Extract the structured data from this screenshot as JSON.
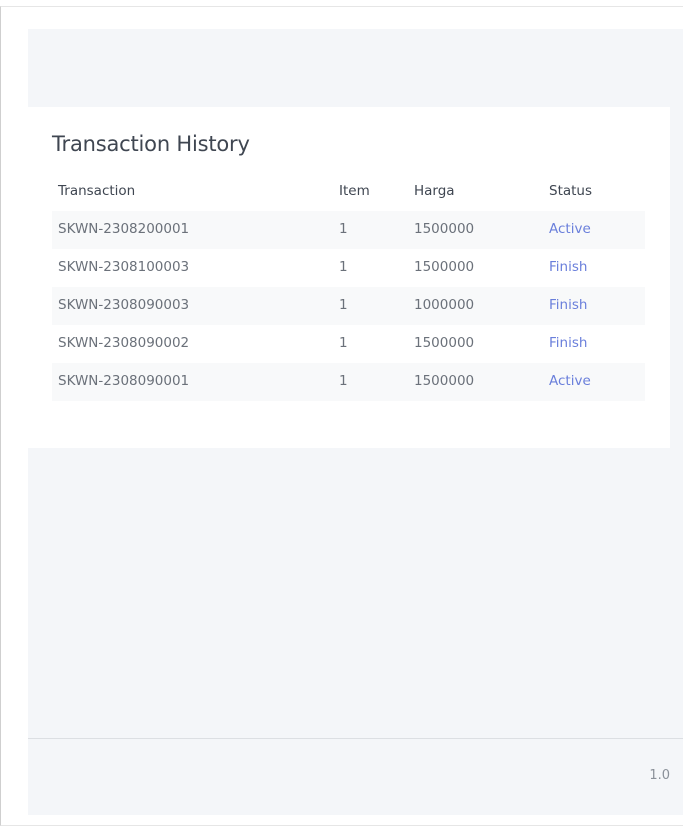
{
  "card": {
    "title": "Transaction History"
  },
  "table": {
    "headers": {
      "transaction": "Transaction",
      "item": "Item",
      "harga": "Harga",
      "status": "Status"
    },
    "rows": [
      {
        "transaction": "SKWN-2308200001",
        "item": "1",
        "harga": "1500000",
        "status": "Active"
      },
      {
        "transaction": "SKWN-2308100003",
        "item": "1",
        "harga": "1500000",
        "status": "Finish"
      },
      {
        "transaction": "SKWN-2308090003",
        "item": "1",
        "harga": "1000000",
        "status": "Finish"
      },
      {
        "transaction": "SKWN-2308090002",
        "item": "1",
        "harga": "1500000",
        "status": "Finish"
      },
      {
        "transaction": "SKWN-2308090001",
        "item": "1",
        "harga": "1500000",
        "status": "Active"
      }
    ]
  },
  "footer": {
    "version": "1.0"
  },
  "colors": {
    "status_link": "#6a7fdb",
    "content_background": "#f4f6f9",
    "card_background": "#ffffff",
    "striped_row": "#f8f9fa"
  }
}
